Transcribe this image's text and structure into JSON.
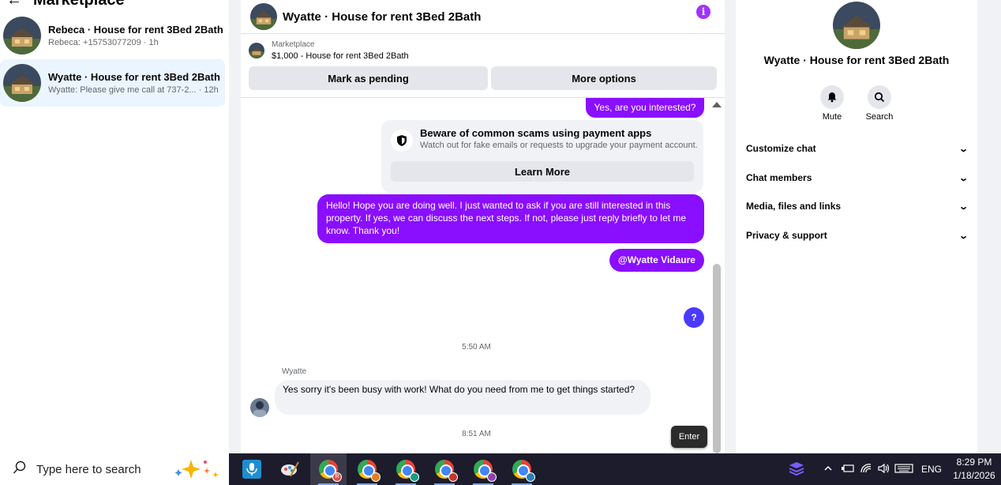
{
  "sidebar": {
    "back_glyph": "←",
    "title": "Marketplace",
    "conversations": [
      {
        "name": "Rebeca · House for rent 3Bed 2Bath",
        "preview": "Rebeca: +15753077209 · 1h"
      },
      {
        "name": "Wyatte · House for rent 3Bed 2Bath",
        "preview": "Wyatte: Please give me call at 737-2... · 12h"
      }
    ]
  },
  "chat": {
    "header_title": "Wyatte · House for rent 3Bed 2Bath",
    "info_glyph": "i",
    "listing": {
      "label": "Marketplace",
      "price_title": "$1,000 - House for rent 3Bed 2Bath",
      "mark_pending_label": "Mark as pending",
      "more_options_label": "More options"
    },
    "messages": {
      "out_1": "Yes, are you interested?",
      "scam_title": "Beware of common scams using payment apps",
      "scam_body": "Watch out for fake emails or requests to upgrade your payment account.",
      "learn_more": "Learn More",
      "out_2": "Hello! Hope you are doing well. I just wanted to ask if you are still interested in this property. If yes, we can discuss the next steps. If not, please just reply briefly to let me know. Thank you!",
      "mention": "@Wyatte Vidaure",
      "qmark": "?",
      "time_1": "5:50 AM",
      "sender": "Wyatte",
      "in_1": "Yes sorry it's been busy with work! What do you need from me to get things started?",
      "time_2": "8:51 AM"
    },
    "enter_label": "Enter"
  },
  "details": {
    "title": "Wyatte · House for rent 3Bed 2Bath",
    "mute_label": "Mute",
    "search_label": "Search",
    "sections": [
      "Customize chat",
      "Chat members",
      "Media, files and links",
      "Privacy & support"
    ],
    "chevron": "⌄"
  },
  "taskbar": {
    "search_placeholder": "Type here to search",
    "language": "ENG",
    "time": "8:29 PM",
    "date": "1/18/2026"
  },
  "colors": {
    "messenger_purple": "#8a0eff",
    "info_purple": "#a033ff",
    "taskbar_bg": "#1c1c2c"
  }
}
